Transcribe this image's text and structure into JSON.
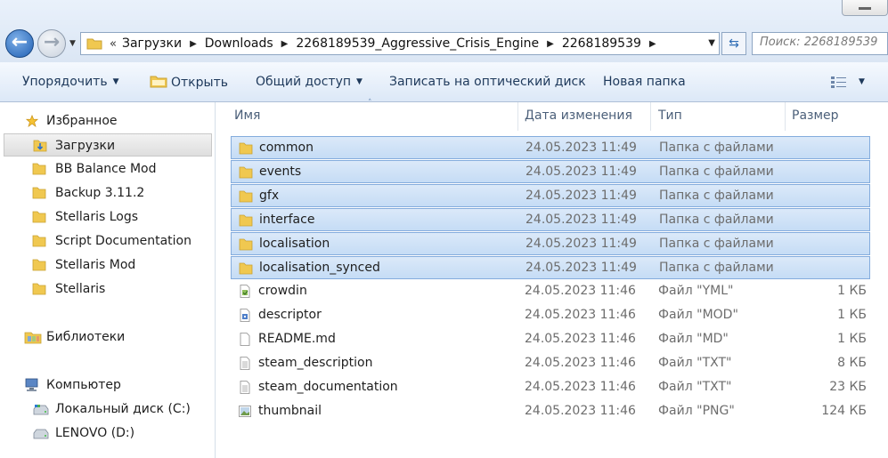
{
  "address": {
    "overflow": "«",
    "crumbs": [
      "Загрузки",
      "Downloads",
      "2268189539_Aggressive_Crisis_Engine",
      "2268189539"
    ]
  },
  "search": {
    "placeholder": "Поиск: 2268189539"
  },
  "toolbar": {
    "organize": "Упорядочить",
    "open": "Открыть",
    "share": "Общий доступ",
    "burn": "Записать на оптический диск",
    "new_folder": "Новая папка"
  },
  "nav": {
    "favorites": "Избранное",
    "fav_items": [
      "Загрузки",
      "BB Balance Mod",
      "Backup 3.11.2",
      "Stellaris Logs",
      "Script Documentation",
      "Stellaris Mod",
      "Stellaris"
    ],
    "libraries": "Библиотеки",
    "computer": "Компьютер",
    "drives": [
      "Локальный диск (C:)",
      "LENOVO (D:)"
    ]
  },
  "columns": {
    "name": "Имя",
    "date": "Дата изменения",
    "type": "Тип",
    "size": "Размер"
  },
  "files": [
    {
      "name": "common",
      "date": "24.05.2023 11:49",
      "type": "Папка с файлами",
      "size": "",
      "icon": "folder-icon",
      "selected": true
    },
    {
      "name": "events",
      "date": "24.05.2023 11:49",
      "type": "Папка с файлами",
      "size": "",
      "icon": "folder-icon",
      "selected": true
    },
    {
      "name": "gfx",
      "date": "24.05.2023 11:49",
      "type": "Папка с файлами",
      "size": "",
      "icon": "folder-icon",
      "selected": true
    },
    {
      "name": "interface",
      "date": "24.05.2023 11:49",
      "type": "Папка с файлами",
      "size": "",
      "icon": "folder-icon",
      "selected": true
    },
    {
      "name": "localisation",
      "date": "24.05.2023 11:49",
      "type": "Папка с файлами",
      "size": "",
      "icon": "folder-icon",
      "selected": true
    },
    {
      "name": "localisation_synced",
      "date": "24.05.2023 11:49",
      "type": "Папка с файлами",
      "size": "",
      "icon": "folder-icon",
      "selected": true
    },
    {
      "name": "crowdin",
      "date": "24.05.2023 11:46",
      "type": "Файл \"YML\"",
      "size": "1 КБ",
      "icon": "yml-file-icon",
      "selected": false
    },
    {
      "name": "descriptor",
      "date": "24.05.2023 11:46",
      "type": "Файл \"MOD\"",
      "size": "1 КБ",
      "icon": "mod-file-icon",
      "selected": false
    },
    {
      "name": "README.md",
      "date": "24.05.2023 11:46",
      "type": "Файл \"MD\"",
      "size": "1 КБ",
      "icon": "blank-file-icon",
      "selected": false
    },
    {
      "name": "steam_description",
      "date": "24.05.2023 11:46",
      "type": "Файл \"TXT\"",
      "size": "8 КБ",
      "icon": "text-file-icon",
      "selected": false
    },
    {
      "name": "steam_documentation",
      "date": "24.05.2023 11:46",
      "type": "Файл \"TXT\"",
      "size": "23 КБ",
      "icon": "text-file-icon",
      "selected": false
    },
    {
      "name": "thumbnail",
      "date": "24.05.2023 11:46",
      "type": "Файл \"PNG\"",
      "size": "124 КБ",
      "icon": "image-file-icon",
      "selected": false
    }
  ],
  "colors": {
    "selection": "#cce0f7",
    "selection_border": "#84acdd",
    "folder": "#f0c850",
    "link": "#1e395b"
  }
}
